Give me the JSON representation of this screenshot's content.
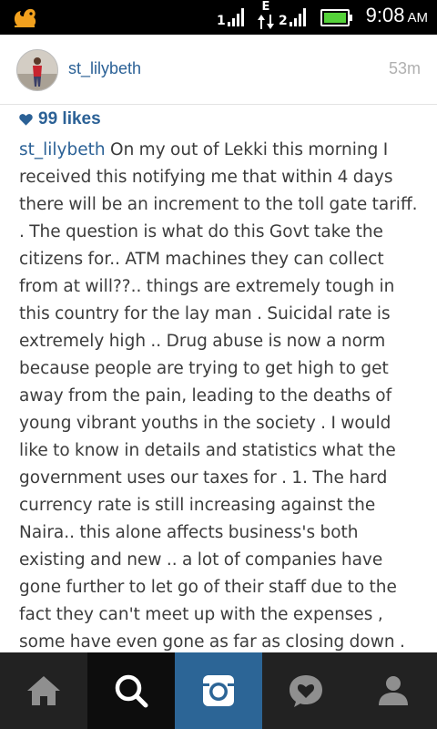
{
  "status_bar": {
    "sim1": "1",
    "sim2": "2",
    "network": "E",
    "time": "9:08",
    "ampm": "AM",
    "battery_color": "#55d23a"
  },
  "post": {
    "username": "st_lilybeth",
    "time_ago": "53m",
    "likes": "99 likes",
    "caption_user": "st_lilybeth",
    "caption_text": "On my out of Lekki this morning I received this notifying me that within 4 days there will be an increment to the toll gate tariff. . The question is what do this Govt take the citizens for.. ATM machines they can collect from at will??.. things are extremely tough in this country for the lay man . Suicidal rate is extremely high .. Drug abuse is now a norm because people are trying to get high to get away from the pain, leading to the deaths of young vibrant youths in the society . I would like to know in details and statistics what the government uses our taxes for . 1. The hard currency rate is still increasing against the Naira.. this alone affects business's both existing and new .. a lot of companies have gone further to let go of their staff due to the fact they can't meet up with the expenses , some have even gone as far as closing down ."
  },
  "nav": {
    "items": [
      "home-icon",
      "search-icon",
      "camera-icon",
      "news-heart-icon",
      "profile-icon"
    ],
    "active": "search-icon",
    "colors": {
      "bar": "#222222",
      "search_bg": "#0d0d0d",
      "camera_bg": "#2c6596",
      "icon_grey": "#8f8f8f"
    }
  },
  "colors": {
    "link": "#2b6196",
    "text": "#3c3c3c",
    "muted": "#b0b0b0"
  }
}
